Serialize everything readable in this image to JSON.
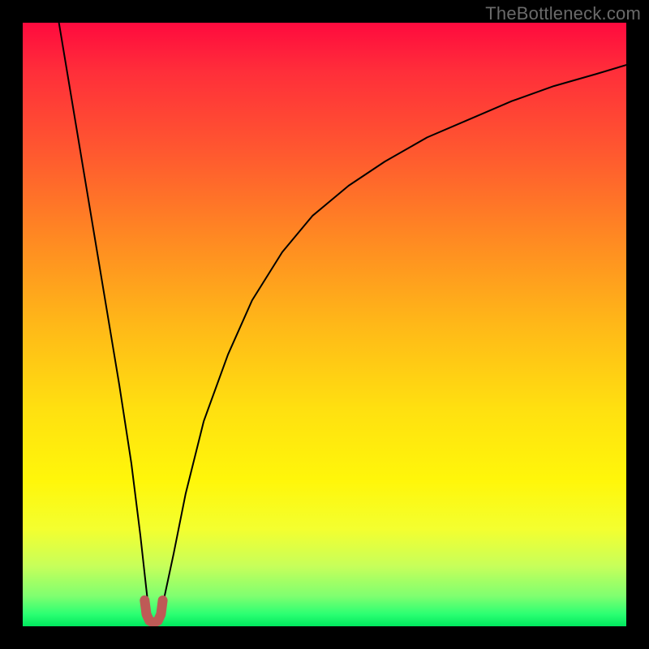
{
  "watermark": "TheBottleneck.com",
  "chart_data": {
    "type": "line",
    "title": "",
    "xlabel": "",
    "ylabel": "",
    "xlim": [
      0,
      100
    ],
    "ylim": [
      0,
      100
    ],
    "legend": false,
    "grid": false,
    "series": [
      {
        "name": "bottleneck-curve",
        "x": [
          6,
          8,
          10,
          12,
          14,
          16,
          18,
          19.5,
          20.5,
          21,
          21.7,
          22.5,
          23.5,
          25,
          27,
          30,
          34,
          38,
          43,
          48,
          54,
          60,
          67,
          74,
          81,
          88,
          95,
          100
        ],
        "y": [
          100,
          88,
          76,
          64,
          52,
          40,
          27,
          15,
          6,
          1.5,
          0.7,
          1.5,
          5,
          12,
          22,
          34,
          45,
          54,
          62,
          68,
          73,
          77,
          81,
          84,
          87,
          89.5,
          91.5,
          93
        ],
        "stroke": "#000000",
        "stroke_width": 2
      },
      {
        "name": "valley-marker",
        "x": [
          20.2,
          20.5,
          21.0,
          21.7,
          22.4,
          22.9,
          23.2
        ],
        "y": [
          4.3,
          2.0,
          0.9,
          0.6,
          0.9,
          2.0,
          4.3
        ],
        "stroke": "#be5a56",
        "stroke_width": 12
      }
    ],
    "background_gradient": {
      "direction": "top-to-bottom",
      "stops": [
        {
          "offset": 0.0,
          "color": "#ff0a3e"
        },
        {
          "offset": 0.5,
          "color": "#ffd014"
        },
        {
          "offset": 0.8,
          "color": "#fff70a"
        },
        {
          "offset": 1.0,
          "color": "#00e85e"
        }
      ]
    }
  }
}
